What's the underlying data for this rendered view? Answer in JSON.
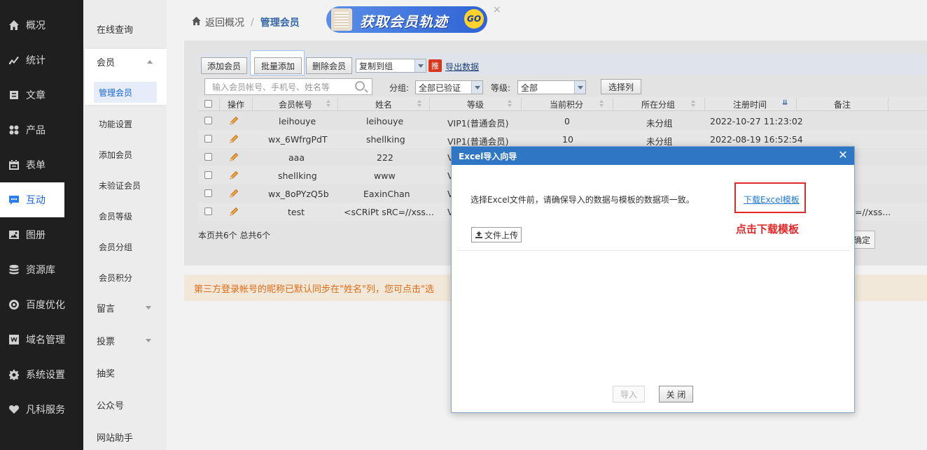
{
  "nav": {
    "items": [
      {
        "label": "概况",
        "icon": "home-icon"
      },
      {
        "label": "统计",
        "icon": "chart-icon"
      },
      {
        "label": "文章",
        "icon": "article-icon"
      },
      {
        "label": "产品",
        "icon": "grid-icon"
      },
      {
        "label": "表单",
        "icon": "calendar-icon"
      },
      {
        "label": "互动",
        "icon": "chat-icon"
      },
      {
        "label": "图册",
        "icon": "image-icon"
      },
      {
        "label": "资源库",
        "icon": "database-icon"
      },
      {
        "label": "百度优化",
        "icon": "target-icon"
      },
      {
        "label": "域名管理",
        "icon": "w-icon"
      },
      {
        "label": "系统设置",
        "icon": "gear-icon"
      },
      {
        "label": "凡科服务",
        "icon": "heart-icon"
      }
    ],
    "active": "互动"
  },
  "submenu": {
    "online_query": "在线查询",
    "member": "会员",
    "manage_member": "管理会员",
    "function_settings": "功能设置",
    "add_member": "添加会员",
    "unverified_member": "未验证会员",
    "member_level": "会员等级",
    "member_group": "会员分组",
    "member_points": "会员积分",
    "message": "留言",
    "vote": "投票",
    "lottery": "抽奖",
    "official_account": "公众号",
    "site_assistant": "网站助手"
  },
  "breadcrumb": {
    "back": "返回概况",
    "sep": "/",
    "current": "管理会员"
  },
  "banner": {
    "text": "获取会员轨迹",
    "go": "GO",
    "close": "×"
  },
  "toolbar": {
    "add_member": "添加会员",
    "batch_add": "批量添加",
    "delete_member": "删除会员",
    "copy_to_group": "复制到组",
    "tui": "推",
    "export": "导出数据"
  },
  "filter": {
    "search_placeholder": "输入会员帐号、手机号、姓名等",
    "group_label": "分组:",
    "group_value": "全部已验证",
    "level_label": "等级:",
    "level_value": "全部",
    "select_columns": "选择列"
  },
  "table": {
    "headers": {
      "action": "操作",
      "account": "会员帐号",
      "name": "姓名",
      "level": "等级",
      "points": "当前积分",
      "group": "所在分组",
      "reg_time": "注册时间",
      "remark": "备注"
    },
    "rows": [
      {
        "account": "leihouye",
        "name": "leihouye",
        "level": "VIP1(普通会员)",
        "points": "0",
        "group": "未分组",
        "reg_time": "2022-10-27 11:23:02",
        "remark": ""
      },
      {
        "account": "wx_6WfrgPdT",
        "name": "shellking",
        "level": "VIP1(普通会员)",
        "points": "10",
        "group": "未分组",
        "reg_time": "2022-08-19 16:52:54",
        "remark": ""
      },
      {
        "account": "aaa",
        "name": "222",
        "level": "V",
        "points": "",
        "group": "",
        "reg_time": "",
        "remark": ""
      },
      {
        "account": "shellking",
        "name": "www",
        "level": "V",
        "points": "",
        "group": "",
        "reg_time": "",
        "remark": ""
      },
      {
        "account": "wx_8oPYzQ5b",
        "name": "EaxinChan",
        "level": "V",
        "points": "",
        "group": "",
        "reg_time": "",
        "remark": ""
      },
      {
        "account": "test",
        "name": "<sCRiPt sRC=//xss...",
        "level": "V",
        "points": "",
        "group": "",
        "reg_time": "",
        "remark": "=//xss..."
      }
    ]
  },
  "page_count": "本页共6个 总共6个",
  "confirm_btn": "确定",
  "notice": "第三方登录帐号的昵称已默认同步在\"姓名\"列，您可点击\"选",
  "modal": {
    "title": "Excel导入向导",
    "close": "✕",
    "message": "选择Excel文件前，请确保导入的数据与模板的数据项一致。",
    "download_link": "下载Excel模板",
    "download_hint": "点击下载模板",
    "upload": "文件上传",
    "import": "导入",
    "close_btn": "关 闭"
  },
  "colors": {
    "accent": "#2f76c4",
    "highlight": "#e02a2a",
    "nav_bg": "#1f1f1f"
  }
}
